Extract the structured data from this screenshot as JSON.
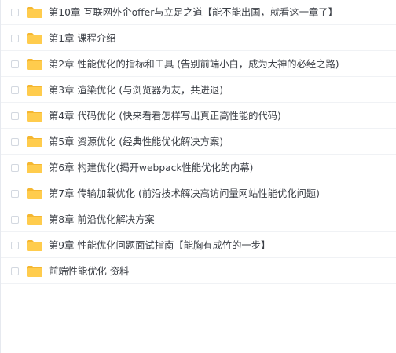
{
  "colors": {
    "folder": "#ffcc4d",
    "folder_tab": "#f5b731",
    "text": "#3b3f46",
    "border": "#f0f2f5"
  },
  "items": [
    {
      "icon": "folder-icon",
      "label": "第10章 互联网外企offer与立足之道【能不能出国，就看这一章了】"
    },
    {
      "icon": "folder-icon",
      "label": "第1章 课程介绍"
    },
    {
      "icon": "folder-icon",
      "label": "第2章 性能优化的指标和工具 (告别前端小白，成为大神的必经之路)"
    },
    {
      "icon": "folder-icon",
      "label": "第3章 渲染优化 (与浏览器为友，共进退)"
    },
    {
      "icon": "folder-icon",
      "label": "第4章 代码优化 (快来看看怎样写出真正高性能的代码)"
    },
    {
      "icon": "folder-icon",
      "label": "第5章 资源优化 (经典性能优化解决方案)"
    },
    {
      "icon": "folder-icon",
      "label": "第6章 构建优化(揭开webpack性能优化的内幕)"
    },
    {
      "icon": "folder-icon",
      "label": "第7章 传输加载优化 (前沿技术解决高访问量网站性能优化问题)"
    },
    {
      "icon": "folder-icon",
      "label": "第8章 前沿优化解决方案"
    },
    {
      "icon": "folder-icon",
      "label": "第9章 性能优化问题面试指南【能胸有成竹的一步】"
    },
    {
      "icon": "folder-icon",
      "label": "前端性能优化 资料"
    }
  ]
}
